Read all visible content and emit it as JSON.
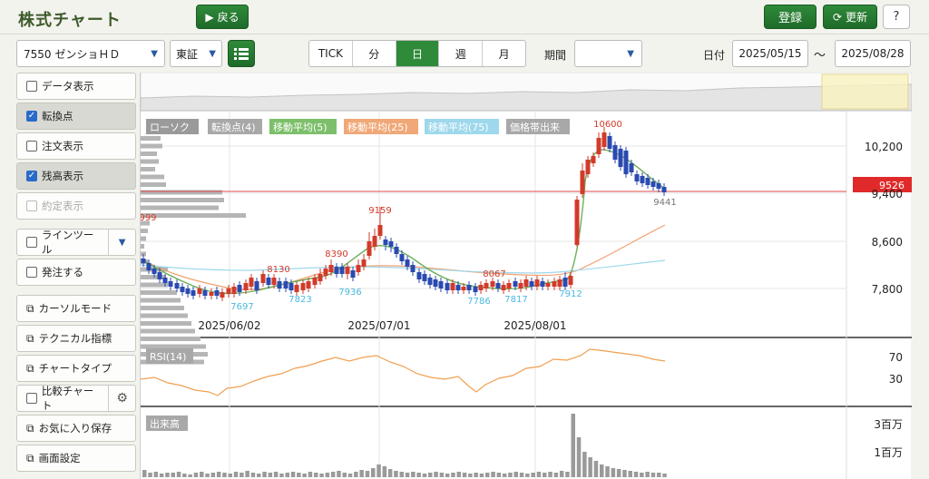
{
  "header": {
    "title": "株式チャート",
    "back_label": "戻る",
    "login_label": "登録",
    "refresh_label": "更新",
    "help_label": "?"
  },
  "toolbar": {
    "stock": "7550 ゼンショＨＤ",
    "market": "東証",
    "tabs": [
      {
        "label": "TICK",
        "active": false
      },
      {
        "label": "分",
        "active": false
      },
      {
        "label": "日",
        "active": true
      },
      {
        "label": "週",
        "active": false
      },
      {
        "label": "月",
        "active": false
      }
    ],
    "period_label": "期間",
    "period_value": "",
    "date_label": "日付",
    "date_from": "2025/05/15",
    "date_sep": "〜",
    "date_to": "2025/08/28"
  },
  "sidebar": {
    "items": [
      {
        "label": "データ表示",
        "type": "check",
        "checked": false
      },
      {
        "label": "転換点",
        "type": "check",
        "checked": true
      },
      {
        "label": "注文表示",
        "type": "check",
        "checked": false
      },
      {
        "label": "残高表示",
        "type": "check",
        "checked": true
      },
      {
        "label": "約定表示",
        "type": "check",
        "checked": false,
        "disabled": true
      },
      {
        "label": "ラインツール",
        "type": "check",
        "checked": false
      },
      {
        "label": "発注する",
        "type": "check",
        "checked": false
      },
      {
        "label": "カーソルモード",
        "type": "window"
      },
      {
        "label": "テクニカル指標",
        "type": "window"
      },
      {
        "label": "チャートタイプ",
        "type": "window"
      },
      {
        "label": "比較チャート",
        "type": "check",
        "checked": false
      },
      {
        "label": "お気に入り保存",
        "type": "window"
      },
      {
        "label": "画面設定",
        "type": "window"
      }
    ]
  },
  "legend": [
    {
      "label": "ローソク",
      "color": "#9a9a9a"
    },
    {
      "label": "転換点(4)",
      "color": "#a8a8a8"
    },
    {
      "label": "移動平均(5)",
      "color": "#7cbf6a"
    },
    {
      "label": "移動平均(25)",
      "color": "#f0a878"
    },
    {
      "label": "移動平均(75)",
      "color": "#9ed8ec"
    },
    {
      "label": "価格帯出来",
      "color": "#a8a8a8"
    }
  ],
  "price_axis": [
    "10,200",
    "9,400",
    "8,600",
    "7,800"
  ],
  "current_price": "9526",
  "date_ticks": [
    "2025/06/02",
    "2025/07/01",
    "2025/08/01"
  ],
  "turning_points": {
    "highs": [
      "999",
      "8130",
      "8390",
      "9159",
      "8067",
      "10600"
    ],
    "lows": [
      "7697",
      "7823",
      "7936",
      "7786",
      "7817",
      "7912",
      "9441"
    ]
  },
  "rsi": {
    "label": "RSI(14)",
    "levels": [
      "70",
      "30"
    ]
  },
  "volume": {
    "label": "出来高",
    "levels": [
      "3百万",
      "1百万"
    ]
  },
  "colors": {
    "up": "#d23a2a",
    "down": "#2a4ab0",
    "accent": "#2f8a3a"
  }
}
